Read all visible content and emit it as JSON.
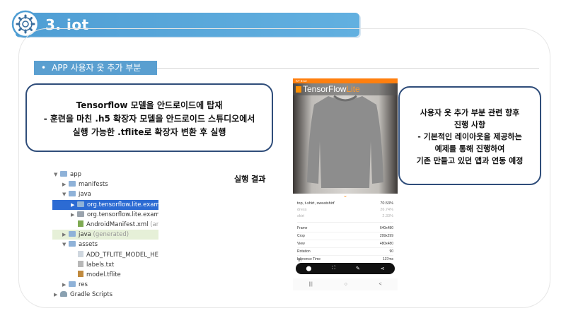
{
  "header": {
    "title": "3. iot",
    "icon": "gear-circuit-icon"
  },
  "section": {
    "label": "APP 사용자 옷 추가 부분"
  },
  "left_callout": {
    "line1": "Tensorflow 모델을 안드로이드에 탑재",
    "line2": "- 훈련을 마친 .h5 확장자 모델을 안드로이드 스튜디오에서",
    "line3": "실행 가능한 .tflite로 확장자 변환 후 실행"
  },
  "right_callout": {
    "line1": "사용자 옷 추가 부분 관련 향후",
    "line2": "진행 사항",
    "line3": "- 기본적인 레이아웃을 제공하는",
    "line4": "예제를 통해 진행하여",
    "line5": "기존 만들고 있던 앱과 연동 예정"
  },
  "result_label": "실행 결과",
  "tree": {
    "app": "app",
    "manifests": "manifests",
    "java": "java",
    "pkg1": "org.tensorflow.lite.examples.c",
    "pkg2": "org.tensorflow.lite.examples.c",
    "manifest_file": "AndroidManifest.xml",
    "manifest_hint": "(androi",
    "java_gen": "java",
    "java_gen_hint": "(generated)",
    "assets": "assets",
    "model_here": "ADD_TFLITE_MODEL_HERE",
    "labels": "labels.txt",
    "model": "model.tflite",
    "res": "res",
    "gradle": "Gradle Scripts"
  },
  "phone": {
    "status_time": "KT 6:12",
    "app_name_tf": "TensorFlow",
    "app_name_lite": "Lite",
    "results": [
      {
        "label": "top, t-shirt, sweatshirt'",
        "value": "70.53%"
      },
      {
        "label": "dress",
        "value": "26.74%"
      },
      {
        "label": "skirt",
        "value": "2.33%"
      }
    ],
    "info": [
      {
        "label": "Frame",
        "value": "640x480"
      },
      {
        "label": "Crop",
        "value": "299x299"
      },
      {
        "label": "View",
        "value": "480x480"
      },
      {
        "label": "Rotation",
        "value": "90"
      },
      {
        "label": "Inference Time",
        "value": "137ms"
      }
    ],
    "threads_label": "Th"
  }
}
